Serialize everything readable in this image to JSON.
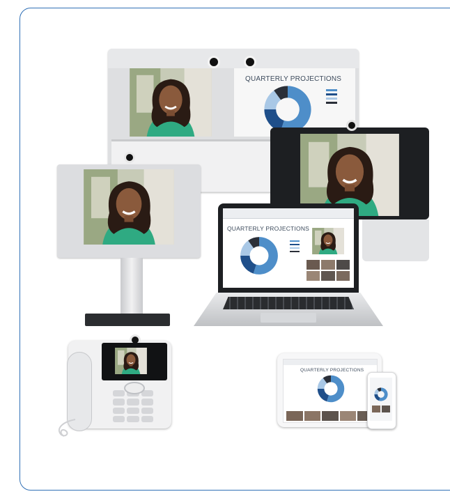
{
  "slide": {
    "title": "QUARTERLY PROJECTIONS"
  },
  "donut": {
    "values": [
      0.55,
      0.2,
      0.15,
      0.1
    ],
    "colors": [
      "#4e8ec9",
      "#1f4f8a",
      "#a9c8e6",
      "#2a2f38"
    ]
  },
  "colors": {
    "frame_border": "#2f6fb5",
    "device_silver": "#d9dadc",
    "device_dark": "#1d1f22"
  },
  "icons": [
    "camera-icon",
    "phone-handset-icon",
    "keypad-icon",
    "donut-chart-icon"
  ]
}
